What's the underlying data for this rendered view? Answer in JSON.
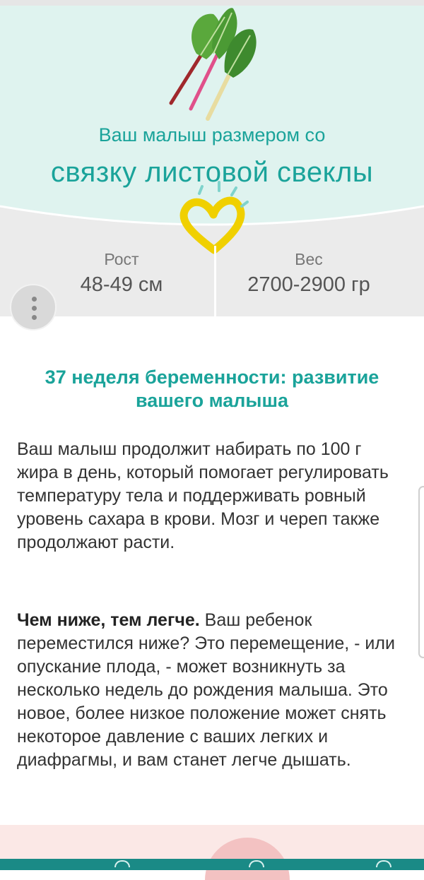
{
  "hero": {
    "intro": "Ваш малыш размером со",
    "fruit_name": "связку листовой свеклы",
    "veg_icon": "chard-icon"
  },
  "stats": {
    "height_label": "Рост",
    "height_value": "48-49 см",
    "weight_label": "Вес",
    "weight_value": "2700-2900 гр"
  },
  "article": {
    "title": "37 неделя беременности: развитие вашего малыша",
    "paragraph1": "Ваш малыш продолжит набирать по 100 г жира в день, который помогает регулировать температуру тела и поддерживать ровный уровень сахара в крови. Мозг и череп также продолжают расти.",
    "paragraph2_bold": "Чем ниже, тем легче.",
    "paragraph2_rest": " Ваш ребенок переместился ниже? Это перемещение, - или опускание плода, - может возникнуть за несколько недель до рождения малыша. Это новое, более низкое положение может снять некоторое давление с ваших легких и диафрагмы, и вам станет легче дышать."
  },
  "colors": {
    "accent": "#1aa39a",
    "hero_bg": "#dff3ef",
    "stats_bg": "#ebebeb",
    "heart": "#f0d000",
    "bottom_bar": "#1a8a86"
  }
}
